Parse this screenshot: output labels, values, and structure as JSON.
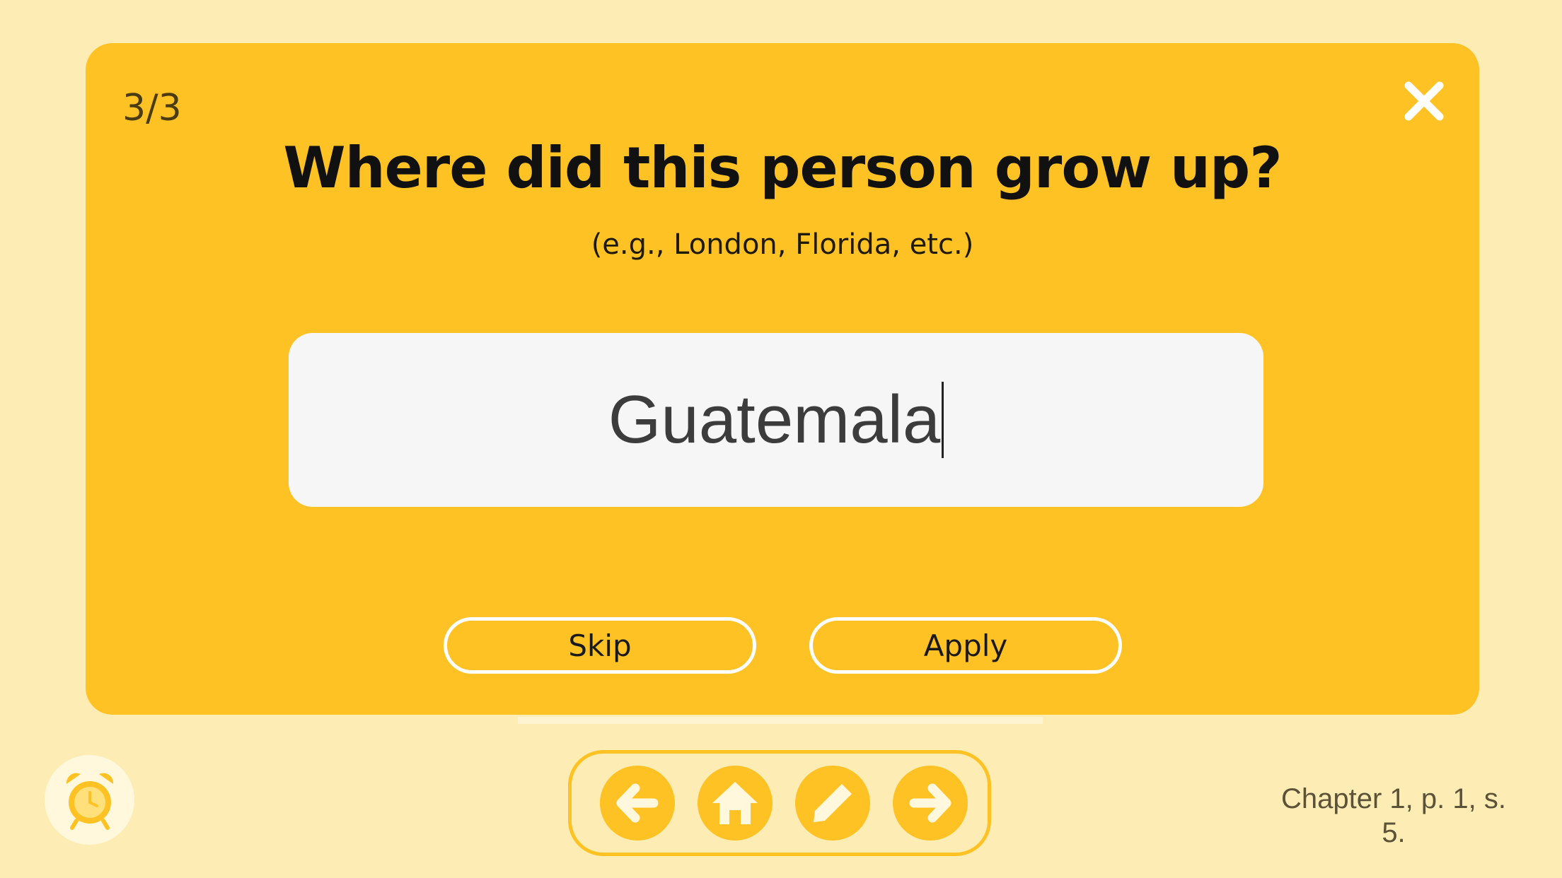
{
  "dialog": {
    "counter": "3/3",
    "question": "Where did this person grow up?",
    "hint": "(e.g., London, Florida, etc.)",
    "answer_value": "Guatemala",
    "close_icon": "close-icon",
    "skip_label": "Skip",
    "apply_label": "Apply"
  },
  "toolbar": {
    "alarm_icon": "alarm-clock-icon",
    "nav_icons": [
      "arrow-left-icon",
      "home-icon",
      "pencil-icon",
      "arrow-right-icon"
    ]
  },
  "location_line1": "Chapter 1, p. 1, s.",
  "location_line2": "5.",
  "colors": {
    "background": "#fdedb5",
    "accent": "#ffc224",
    "field": "#f6f6f6",
    "text": "#111111"
  }
}
